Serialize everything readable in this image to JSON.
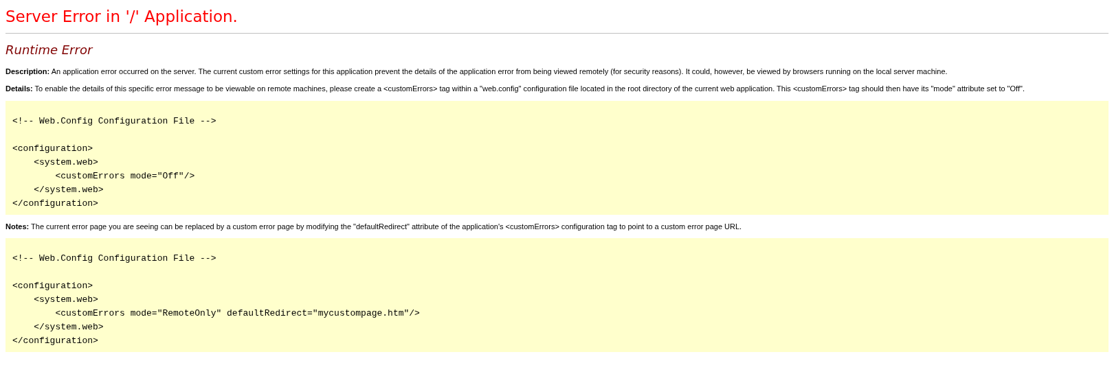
{
  "page_title": "Server Error in '/' Application.",
  "error_heading": "Runtime Error",
  "description": "**Description:** An application error occurred on the server. The current custom error settings for this application prevent the details of the application error from being viewed remotely (for security reasons). It could, however, be viewed by browsers running on the local server machine.",
  "details": "**Details:** To enable the details of this specific error message to be viewable on remote machines, please create a <customErrors> tag within a \"web.config\" configuration file located in the root directory of the current web application. This <customErrors> tag should then have its \"mode\" attribute set to \"Off\".",
  "code_block_1": "<!-- Web.Config Configuration File -->\n\n<configuration>\n    <system.web>\n        <customErrors mode=\"Off\"/>\n    </system.web>\n</configuration>",
  "notes": "**Notes:** The current error page you are seeing can be replaced by a custom error page by modifying the \"defaultRedirect\" attribute of the application's <customErrors> configuration tag to point to a custom error page URL.",
  "code_block_2": "<!-- Web.Config Configuration File -->\n\n<configuration>\n    <system.web>\n        <customErrors mode=\"RemoteOnly\" defaultRedirect=\"mycustompage.htm\"/>\n    </system.web>\n</configuration>"
}
